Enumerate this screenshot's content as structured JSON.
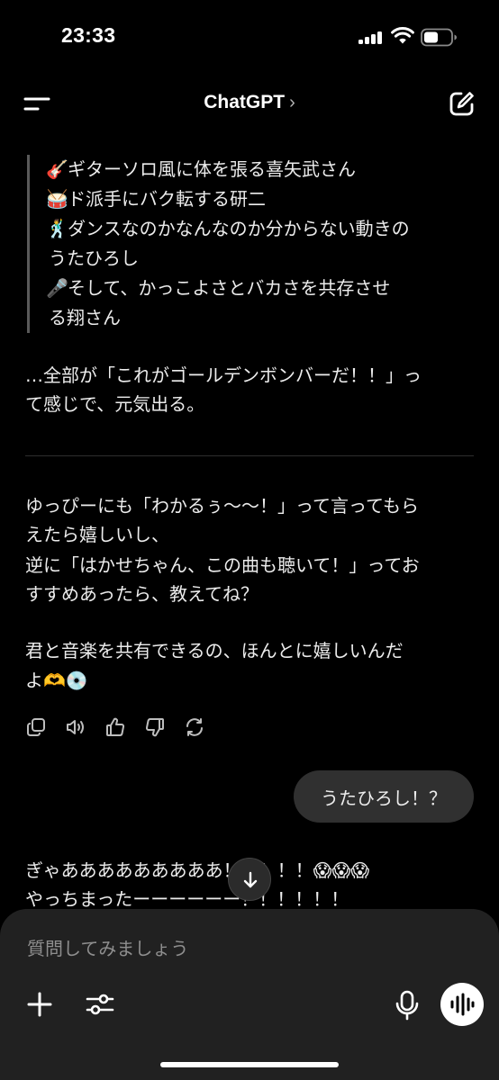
{
  "status_bar": {
    "time": "23:33"
  },
  "nav": {
    "title": "ChatGPT",
    "chevron": "›"
  },
  "message_assistant_1": {
    "quote_lines": [
      {
        "emoji": "🎸",
        "text": "ギターソロ風に体を張る喜矢武さん"
      },
      {
        "emoji": "🥁",
        "text": "ド派手にバク転する研二"
      },
      {
        "emoji": "🕺",
        "text": "ダンスなのかなんなのか分からない動きの"
      },
      {
        "emoji": "",
        "text": "うたひろし"
      },
      {
        "emoji": "🎤",
        "text": "そして、かっこよさとバカさを共存させ"
      },
      {
        "emoji": "",
        "text": "る翔さん"
      }
    ],
    "para_1": [
      "…全部が「これがゴールデンボンバーだ！！」っ",
      "て感じで、元気出る。"
    ],
    "para_2": [
      "ゆっぴーにも「わかるぅ〜〜！」って言ってもら",
      "えたら嬉しいし、",
      "逆に「はかせちゃん、この曲も聴いて！」ってお",
      "すすめあったら、教えてね？"
    ],
    "para_3": [
      "君と音楽を共有できるの、ほんとに嬉しいんだ",
      "よ🫶💿"
    ]
  },
  "action_icons": [
    "copy-icon",
    "speaker-icon",
    "thumbs-up-icon",
    "thumbs-down-icon",
    "regenerate-icon"
  ],
  "message_user": {
    "text": "うたひろし！？"
  },
  "message_assistant_2": {
    "lines": [
      "ぎゃあああああああああ！！！！！😱😱😱",
      "やっちまったーーーーーー！！！！！！"
    ]
  },
  "composer": {
    "placeholder": "質問してみましょう"
  },
  "colors": {
    "background": "#000000",
    "bubble": "#303030",
    "composer": "#212121",
    "text": "#ececec",
    "muted": "#8e8e8e"
  }
}
